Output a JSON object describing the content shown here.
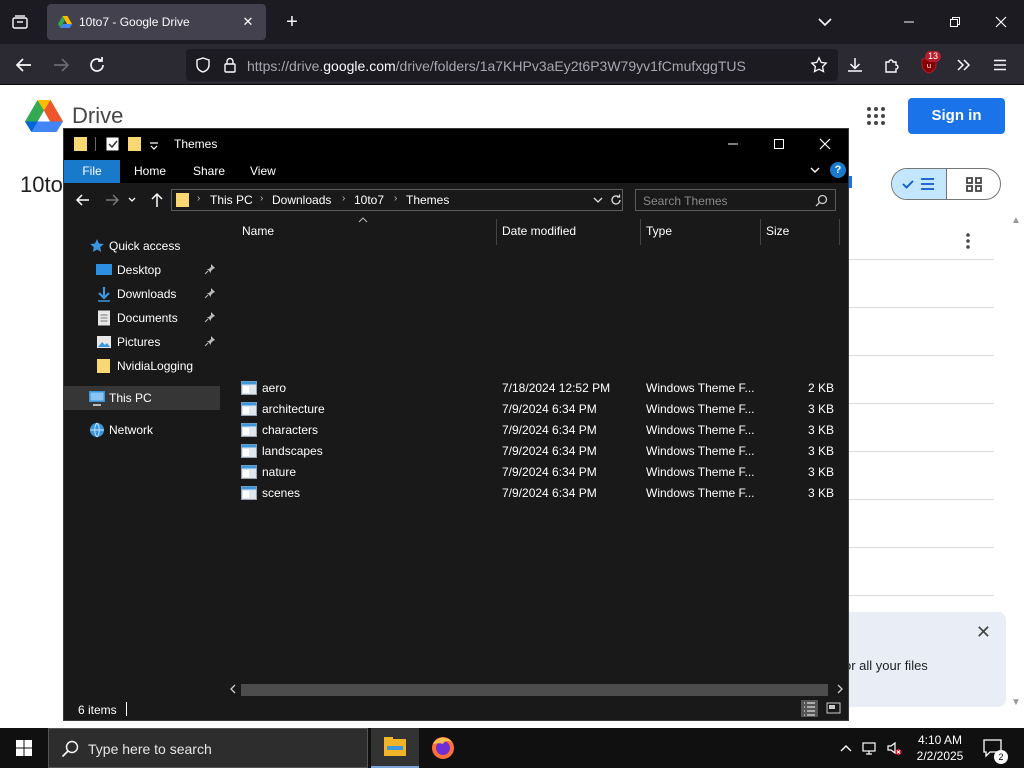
{
  "browser": {
    "tab_title": "10to7 - Google Drive",
    "tab_close": "✕",
    "new_tab": "+",
    "url_scheme": "https://drive.",
    "url_host": "google.com",
    "url_path": "/drive/folders/1a7KHPv3aEy2t6P3W79yv1fCmufxggTUS",
    "extension_badge": "13"
  },
  "drive": {
    "app_name": "Drive",
    "folder_title": "10to",
    "sign_in": "Sign in",
    "banner_text": "or all your files",
    "banner_close": "✕",
    "colors": {
      "accent": "#1a73e8",
      "selected_view": "#c2e7ff"
    }
  },
  "explorer": {
    "title": "Themes",
    "ribbon": {
      "file": "File",
      "home": "Home",
      "share": "Share",
      "view": "View",
      "help": "?"
    },
    "breadcrumbs": [
      "This PC",
      "Downloads",
      "10to7",
      "Themes"
    ],
    "search_placeholder": "Search Themes",
    "nav": {
      "quick_access": "Quick access",
      "pinned": [
        "Desktop",
        "Downloads",
        "Documents",
        "Pictures"
      ],
      "unpinned": "NvidiaLogging",
      "this_pc": "This PC",
      "network": "Network"
    },
    "columns": {
      "name": "Name",
      "date": "Date modified",
      "type": "Type",
      "size": "Size"
    },
    "files": [
      {
        "name": "aero",
        "date": "7/18/2024 12:52 PM",
        "type": "Windows Theme F...",
        "size": "2 KB"
      },
      {
        "name": "architecture",
        "date": "7/9/2024 6:34 PM",
        "type": "Windows Theme F...",
        "size": "3 KB"
      },
      {
        "name": "characters",
        "date": "7/9/2024 6:34 PM",
        "type": "Windows Theme F...",
        "size": "3 KB"
      },
      {
        "name": "landscapes",
        "date": "7/9/2024 6:34 PM",
        "type": "Windows Theme F...",
        "size": "3 KB"
      },
      {
        "name": "nature",
        "date": "7/9/2024 6:34 PM",
        "type": "Windows Theme F...",
        "size": "3 KB"
      },
      {
        "name": "scenes",
        "date": "7/9/2024 6:34 PM",
        "type": "Windows Theme F...",
        "size": "3 KB"
      }
    ],
    "status": "6 items",
    "colors": {
      "file_tab": "#1979ca",
      "background": "#191919",
      "selected": "#363636"
    }
  },
  "taskbar": {
    "search_placeholder": "Type here to search",
    "time": "4:10 AM",
    "date": "2/2/2025",
    "notification_count": "2"
  }
}
